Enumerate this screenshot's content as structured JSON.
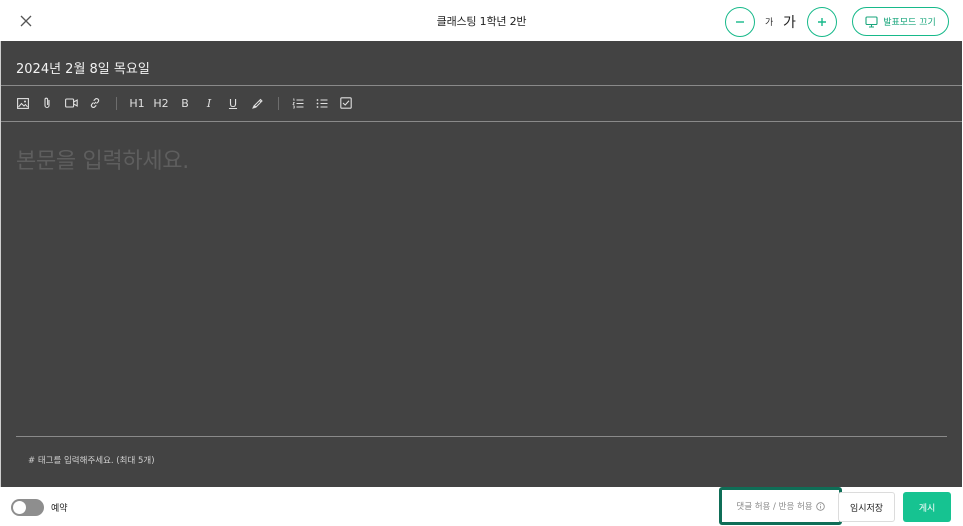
{
  "header": {
    "title": "클래스팅 1학년 2반",
    "font_small_label": "가",
    "font_large_label": "가",
    "present_mode_label": "발표모드 끄기"
  },
  "editor": {
    "date": "2024년 2월 8일 목요일",
    "body_placeholder": "본문을 입력하세요.",
    "tag_placeholder": "# 태그를 입력해주세요. (최대 5개)",
    "toolbar": {
      "h1": "H1",
      "h2": "H2",
      "bold": "B",
      "italic": "I",
      "underline": "U"
    }
  },
  "footer": {
    "reserve_label": "예약",
    "reserve_on": false,
    "comment_setting_label": "댓글 허용 / 반응 허용",
    "draft_label": "임시저장",
    "post_label": "게시"
  },
  "colors": {
    "accent": "#17b98a",
    "post_button": "#16c391",
    "editor_bg": "#434343",
    "highlight_border": "#0f6e57"
  },
  "icons": [
    "close-icon",
    "minus-icon",
    "plus-icon",
    "monitor-icon",
    "image-icon",
    "paperclip-icon",
    "video-icon",
    "link-icon",
    "highlighter-icon",
    "numbered-list-icon",
    "bullet-list-icon",
    "checkbox-icon",
    "info-icon"
  ]
}
